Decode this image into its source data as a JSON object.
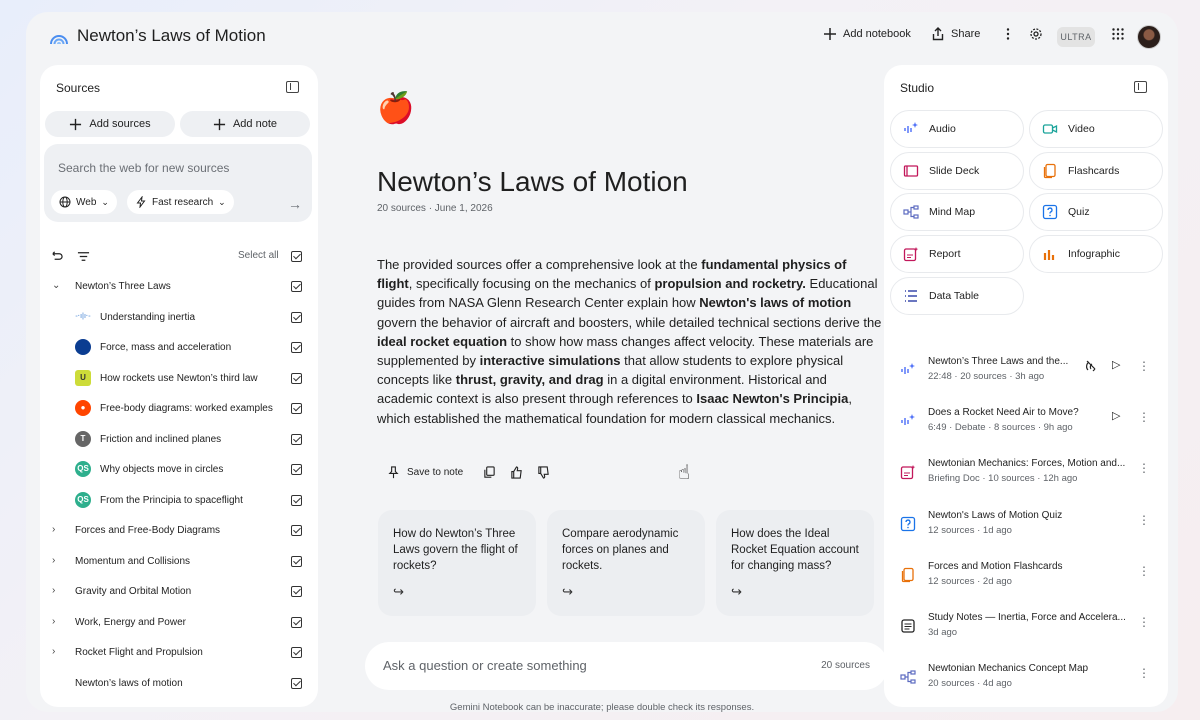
{
  "header": {
    "title": "Newton’s Laws of Motion",
    "add_notebook": "Add notebook",
    "share": "Share",
    "badge": "ULTRA"
  },
  "sources": {
    "title": "Sources",
    "add_sources": "Add sources",
    "add_note": "Add note",
    "search_placeholder": "Search the web for new sources",
    "web_chip": "Web",
    "research_chip": "Fast research",
    "select_all": "Select all",
    "items": [
      {
        "label": "Newton’s Three Laws",
        "type": "folder",
        "expanded": true
      },
      {
        "label": "Understanding inertia",
        "type": "source",
        "icon": "waveform-icon"
      },
      {
        "label": "Force, mass and acceleration",
        "type": "source",
        "icon": "nasa-logo-icon"
      },
      {
        "label": "How rockets use Newton’s third law",
        "type": "source",
        "icon": "ui-logo-icon"
      },
      {
        "label": "Free-body diagrams: worked examples",
        "type": "source",
        "icon": "reddit-icon"
      },
      {
        "label": "Friction and inclined planes",
        "type": "source",
        "icon": "t-logo-icon"
      },
      {
        "label": "Why objects move in circles",
        "type": "source",
        "icon": "qs-logo-icon"
      },
      {
        "label": "From the Principia to spaceflight",
        "type": "source",
        "icon": "qs-logo-icon"
      },
      {
        "label": "Forces and Free-Body Diagrams",
        "type": "folder",
        "expanded": false
      },
      {
        "label": "Momentum and Collisions",
        "type": "folder",
        "expanded": false
      },
      {
        "label": "Gravity and Orbital Motion",
        "type": "folder",
        "expanded": false
      },
      {
        "label": "Work, Energy and Power",
        "type": "folder",
        "expanded": false
      },
      {
        "label": "Rocket Flight and Propulsion",
        "type": "folder",
        "expanded": false
      },
      {
        "label": "Newton’s laws of motion",
        "type": "plain"
      }
    ]
  },
  "chat": {
    "emoji": "🍎",
    "title": "Newton’s Laws of Motion",
    "meta": "20 sources · June 1, 2026",
    "summary_parts": [
      {
        "t": "The provided sources offer a comprehensive look at the ",
        "b": false
      },
      {
        "t": "fundamental physics of flight",
        "b": true
      },
      {
        "t": ", specifically focusing on the mechanics of ",
        "b": false
      },
      {
        "t": "propulsion and rocketry.",
        "b": true
      },
      {
        "t": " Educational guides from NASA Glenn Research Center explain how ",
        "b": false
      },
      {
        "t": "Newton's laws of motion",
        "b": true
      },
      {
        "t": " govern the behavior of aircraft and boosters, while detailed technical sections derive the ",
        "b": false
      },
      {
        "t": "ideal rocket equation",
        "b": true
      },
      {
        "t": " to show how mass changes affect velocity. These materials are supplemented by ",
        "b": false
      },
      {
        "t": "interactive simulations",
        "b": true
      },
      {
        "t": " that allow students to explore physical concepts like ",
        "b": false
      },
      {
        "t": "thrust, gravity, and drag",
        "b": true
      },
      {
        "t": " in a digital environment. Historical and academic context is also present through references to ",
        "b": false
      },
      {
        "t": "Isaac Newton's Principia",
        "b": true
      },
      {
        "t": ", which established the mathematical foundation for modern classical mechanics.",
        "b": false
      }
    ],
    "save_to_note": "Save to note",
    "suggestions": [
      "How do Newton’s Three Laws govern the flight of rockets?",
      "Compare aerodynamic forces on planes and rockets.",
      "How does the Ideal Rocket Equation account for changing mass?"
    ],
    "ask_placeholder": "Ask a question or create something",
    "ask_count": "20 sources",
    "disclaimer": "Gemini Notebook can be inaccurate; please double check its responses."
  },
  "studio": {
    "title": "Studio",
    "tiles": [
      {
        "label": "Audio",
        "icon": "audio-sparkle-icon",
        "color": "#4a6cf7"
      },
      {
        "label": "Video",
        "icon": "video-icon",
        "color": "#1aa39a"
      },
      {
        "label": "Slide Deck",
        "icon": "slides-icon",
        "color": "#c2185b"
      },
      {
        "label": "Flashcards",
        "icon": "flashcards-icon",
        "color": "#e8710a"
      },
      {
        "label": "Mind Map",
        "icon": "mind-map-icon",
        "color": "#5c6bc0"
      },
      {
        "label": "Quiz",
        "icon": "quiz-icon",
        "color": "#1a73e8"
      },
      {
        "label": "Report",
        "icon": "report-icon",
        "color": "#c2185b"
      },
      {
        "label": "Infographic",
        "icon": "infographic-icon",
        "color": "#e8710a"
      },
      {
        "label": "Data Table",
        "icon": "data-table-icon",
        "color": "#3949ab"
      }
    ],
    "artifacts": [
      {
        "title": "Newton’s Three Laws and the...",
        "meta": "22:48 · 20 sources · 3h ago",
        "icon": "audio-sparkle-icon",
        "voice": true,
        "play": true
      },
      {
        "title": "Does a Rocket Need Air to Move?",
        "meta": "6:49 · Debate · 8 sources · 9h ago",
        "icon": "audio-sparkle-icon",
        "voice": false,
        "play": true
      },
      {
        "title": "Newtonian Mechanics: Forces, Motion and...",
        "meta": "Briefing Doc · 10 sources · 12h ago",
        "icon": "report-icon",
        "voice": false,
        "play": false
      },
      {
        "title": "Newton's Laws of Motion Quiz",
        "meta": "12 sources · 1d ago",
        "icon": "quiz-icon",
        "voice": false,
        "play": false
      },
      {
        "title": "Forces and Motion Flashcards",
        "meta": "12 sources · 2d ago",
        "icon": "flashcards-icon",
        "voice": false,
        "play": false
      },
      {
        "title": "Study Notes — Inertia, Force and Accelera...",
        "meta": "3d ago",
        "icon": "note-icon",
        "voice": false,
        "play": false
      },
      {
        "title": "Newtonian Mechanics Concept Map",
        "meta": "20 sources · 4d ago",
        "icon": "mind-map-icon",
        "voice": false,
        "play": false
      }
    ]
  }
}
